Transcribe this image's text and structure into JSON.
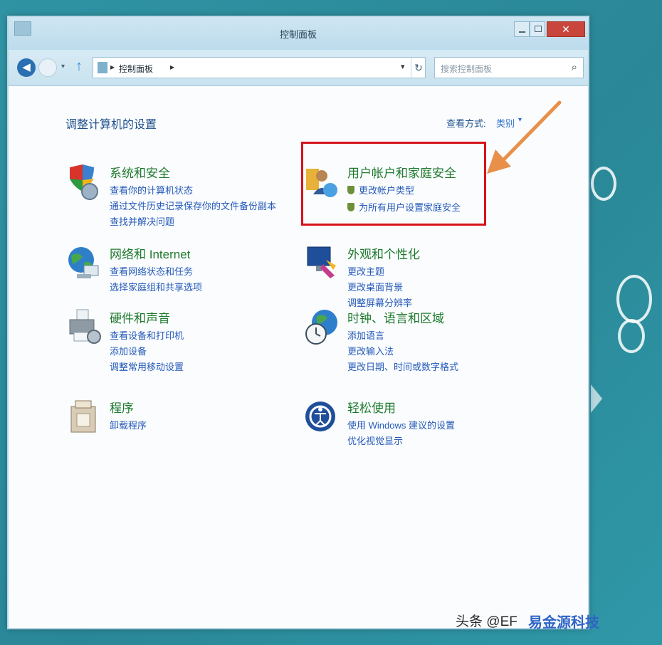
{
  "window": {
    "title": "控制面板"
  },
  "addressbar": {
    "back_glyph": "◀",
    "path_sep": "▸",
    "path": "控制面板",
    "refresh_glyph": "↻",
    "search_placeholder": "搜索控制面板",
    "search_glyph": "⌕"
  },
  "content": {
    "heading": "调整计算机的设置",
    "view_by_label": "查看方式:",
    "view_by_value": "类别",
    "categories": [
      {
        "title": "系统和安全",
        "links": [
          "查看你的计算机状态",
          "通过文件历史记录保存你的文件备份副本",
          "查找并解决问题"
        ]
      },
      {
        "title": "用户帐户和家庭安全",
        "links": [
          "更改帐户类型",
          "为所有用户设置家庭安全"
        ]
      },
      {
        "title": "网络和 Internet",
        "links": [
          "查看网络状态和任务",
          "选择家庭组和共享选项"
        ]
      },
      {
        "title": "外观和个性化",
        "links": [
          "更改主题",
          "更改桌面背景",
          "调整屏幕分辨率"
        ]
      },
      {
        "title": "硬件和声音",
        "links": [
          "查看设备和打印机",
          "添加设备",
          "调整常用移动设置"
        ]
      },
      {
        "title": "时钟、语言和区域",
        "links": [
          "添加语言",
          "更改输入法",
          "更改日期、时间或数字格式"
        ]
      },
      {
        "title": "程序",
        "links": [
          "卸载程序"
        ]
      },
      {
        "title": "轻松使用",
        "links": [
          "使用 Windows 建议的设置",
          "优化视觉显示"
        ]
      }
    ]
  },
  "watermark": {
    "text": "头条 @EF",
    "logo": "易金源科技"
  },
  "colors": {
    "highlight": "#d7131a",
    "arrow": "#e8904a",
    "link": "#2459b8",
    "category_title": "#1e7a2c"
  }
}
